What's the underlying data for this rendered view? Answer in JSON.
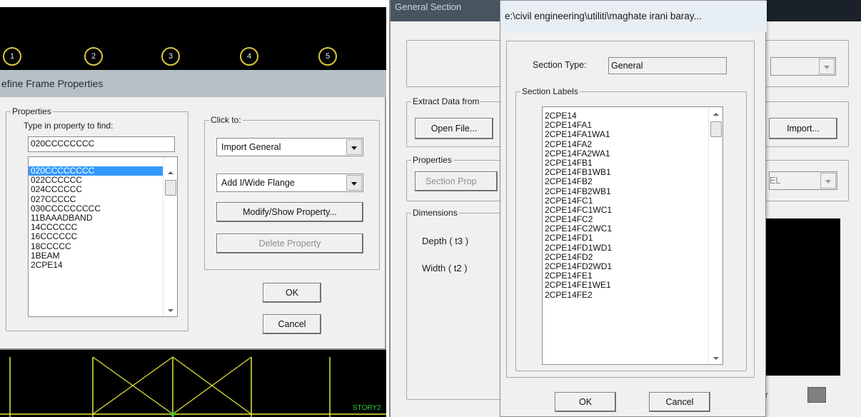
{
  "left_window": {
    "grid_bubbles": [
      "1",
      "2",
      "3",
      "4",
      "5"
    ],
    "title": "efine Frame Properties",
    "properties_group": "Properties",
    "find_label": "Type in property to find:",
    "find_value": "020CCCCCCCC",
    "property_list": [
      "020CCCCCCCC",
      "022CCCCCC",
      "024CCCCCC",
      "027CCCCC",
      "030CCCCCCCCC",
      "11BAAADBAND",
      "14CCCCCC",
      "16CCCCCC",
      "18CCCCC",
      "1BEAM",
      "2CPE14"
    ],
    "selected_index": 0,
    "click_to_group": "Click to:",
    "import_combo": "Import General",
    "add_combo": "Add I/Wide Flange",
    "modify_button": "Modify/Show Property...",
    "delete_button": "Delete Property",
    "ok_button": "OK",
    "cancel_button": "Cancel",
    "story_label": "STORY2"
  },
  "general_section": {
    "title": "General Section",
    "extract_group": "Extract Data from",
    "open_file_button": "Open File...",
    "import_button": "Import...",
    "properties_group": "Properties",
    "section_prop_button": "Section Prop",
    "material_combo": "EL",
    "dimensions_group": "Dimensions",
    "depth_label": "Depth  ( t3 )",
    "width_label": "Width  ( t2 )",
    "color_label": "or"
  },
  "labels_dialog": {
    "title": "e:\\civil engineering\\utiliti\\maghate irani baray...",
    "section_type_label": "Section Type:",
    "section_type_value": "General",
    "section_labels_group": "Section Labels",
    "labels": [
      "2CPE14",
      "2CPE14FA1",
      "2CPE14FA1WA1",
      "2CPE14FA2",
      "2CPE14FA2WA1",
      "2CPE14FB1",
      "2CPE14FB1WB1",
      "2CPE14FB2",
      "2CPE14FB2WB1",
      "2CPE14FC1",
      "2CPE14FC1WC1",
      "2CPE14FC2",
      "2CPE14FC2WC1",
      "2CPE14FD1",
      "2CPE14FD1WD1",
      "2CPE14FD2",
      "2CPE14FD2WD1",
      "2CPE14FE1",
      "2CPE14FE1WE1",
      "2CPE14FE2"
    ],
    "ok_button": "OK",
    "cancel_button": "Cancel"
  },
  "colors": {
    "grid_bubble": "#d9c63f",
    "frame_yellow": "#e8e83a",
    "selection": "#3399ff",
    "story_text": "#2fcf2f"
  }
}
